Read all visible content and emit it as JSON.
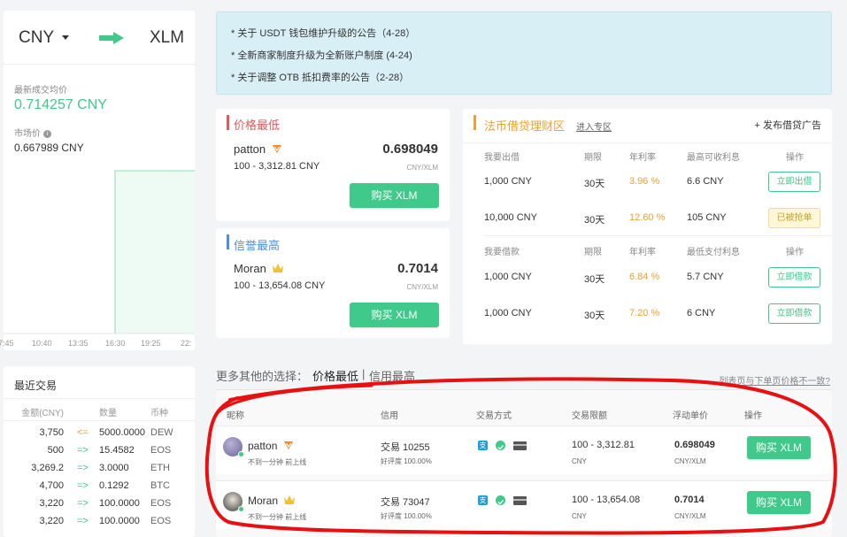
{
  "pair": {
    "from": "CNY",
    "to": "XLM"
  },
  "stats": {
    "latest_label": "最新成交均价",
    "latest_value": "0.714257 CNY",
    "market_label": "市场价",
    "market_value": "0.667989 CNY",
    "chart_xticks": [
      "7:45",
      "10:40",
      "13:35",
      "16:30",
      "19:25",
      "22:"
    ]
  },
  "announcements": [
    "* 关于 USDT 钱包维护升级的公告（4-28）",
    "* 全新商家制度升级为全新账户制度 (4-24)",
    "* 关于调整 OTB 抵扣费率的公告（2-28）"
  ],
  "lowest_price": {
    "title": "价格最低",
    "name": "patton",
    "price": "0.698049",
    "range": "100 - 3,312.81 CNY",
    "unit": "CNY/XLM",
    "button": "购买 XLM"
  },
  "best_credit": {
    "title": "信誉最高",
    "name": "Moran",
    "price": "0.7014",
    "range": "100 - 13,654.08 CNY",
    "unit": "CNY/XLM",
    "button": "购买 XLM"
  },
  "lending": {
    "title": "法币借贷理财区",
    "enter_link": "进入专区",
    "publish": "+ 发布借贷广告",
    "lend_headers": [
      "我要出借",
      "期限",
      "年利率",
      "最高可收利息",
      "操作"
    ],
    "lend_rows": [
      {
        "amount": "1,000 CNY",
        "term": "30天",
        "rate": "3.96 %",
        "interest": "6.6 CNY",
        "action": "立即出借",
        "taken": false
      },
      {
        "amount": "10,000 CNY",
        "term": "30天",
        "rate": "12.60 %",
        "interest": "105 CNY",
        "action": "已被抢单",
        "taken": true
      }
    ],
    "borrow_headers": [
      "我要借款",
      "期限",
      "年利率",
      "最低支付利息",
      "操作"
    ],
    "borrow_rows": [
      {
        "amount": "1,000 CNY",
        "term": "30天",
        "rate": "6.84 %",
        "interest": "5.7 CNY",
        "action": "立即借款"
      },
      {
        "amount": "1,000 CNY",
        "term": "30天",
        "rate": "7.20 %",
        "interest": "6 CNY",
        "action": "立即借款"
      }
    ]
  },
  "recent": {
    "title": "最近交易",
    "headers": [
      "金额(CNY)",
      "数量",
      "币种"
    ],
    "rows": [
      {
        "amount": "3,750",
        "arrow": "<=",
        "qty": "5000.0000",
        "coin": "DEW"
      },
      {
        "amount": "500",
        "arrow": "=>",
        "qty": "15.4582",
        "coin": "EOS"
      },
      {
        "amount": "3,269.2",
        "arrow": "=>",
        "qty": "3.0000",
        "coin": "ETH"
      },
      {
        "amount": "4,700",
        "arrow": "=>",
        "qty": "0.1292",
        "coin": "BTC"
      },
      {
        "amount": "3,220",
        "arrow": "=>",
        "qty": "100.0000",
        "coin": "EOS"
      },
      {
        "amount": "3,220",
        "arrow": "=>",
        "qty": "100.0000",
        "coin": "EOS"
      }
    ]
  },
  "more": {
    "label": "更多其他的选择：",
    "tab_price": "价格最低",
    "sep": "|",
    "tab_credit": "信用最高",
    "mismatch": "列表页与下单页价格不一致?"
  },
  "list": {
    "headers": [
      "昵称",
      "信用",
      "交易方式",
      "交易限额",
      "浮动单价",
      "操作"
    ],
    "rows": [
      {
        "name": "patton",
        "status": "不到一分钟 前上线",
        "trades": "交易 10255",
        "rating": "好评度 100.00%",
        "range": "100 - 3,312.81",
        "currency": "CNY",
        "price": "0.698049",
        "unit": "CNY/XLM",
        "button": "购买 XLM"
      },
      {
        "name": "Moran",
        "status": "不到一分钟 前上线",
        "trades": "交易 73047",
        "rating": "好评度 100.00%",
        "range": "100 - 13,654.08",
        "currency": "CNY",
        "price": "0.7014",
        "unit": "CNY/XLM",
        "button": "购买 XLM"
      }
    ]
  },
  "colors": {
    "green": "#3fc98a",
    "orange": "#f0a030",
    "red_accent": "#e05a5a",
    "blue_accent": "#4a90e2",
    "announce_bg": "#d9eff6"
  }
}
